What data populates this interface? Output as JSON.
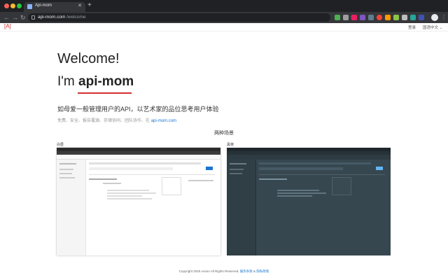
{
  "browser": {
    "tab_title": "Api-mom",
    "url_host": "api-mom.com",
    "url_path": "/welcome"
  },
  "header": {
    "logo": "[A]",
    "nav": [
      "登录",
      "国语中文 ⌄"
    ]
  },
  "hero": {
    "welcome": "Welcome!",
    "im_prefix": "I'm",
    "brand": "api-mom",
    "tagline": "如母爱一般管理用户的API，以艺术家的品位思考用户体验",
    "features_text": "免费、安全、报告覆源、存储协同、团队协作、在",
    "features_link": "api-mom.com"
  },
  "scenes": {
    "title": "两种场景",
    "light_label": "白昼",
    "dark_label": "黑夜"
  },
  "footer": {
    "copyright": "Copyright 2020 Axiom All Rights Reserved.",
    "terms": "服务条款",
    "sep": "&",
    "privacy": "隐私政策"
  },
  "colors": {
    "accent_red": "#d32f2f",
    "link_blue": "#1976d2",
    "chrome_dark": "#202124",
    "dark_theme_bg": "#37474f"
  },
  "icons": {
    "back": "back-arrow-icon",
    "forward": "forward-arrow-icon",
    "reload": "reload-icon",
    "bookmark": "star-icon",
    "menu": "kebab-menu-icon"
  }
}
